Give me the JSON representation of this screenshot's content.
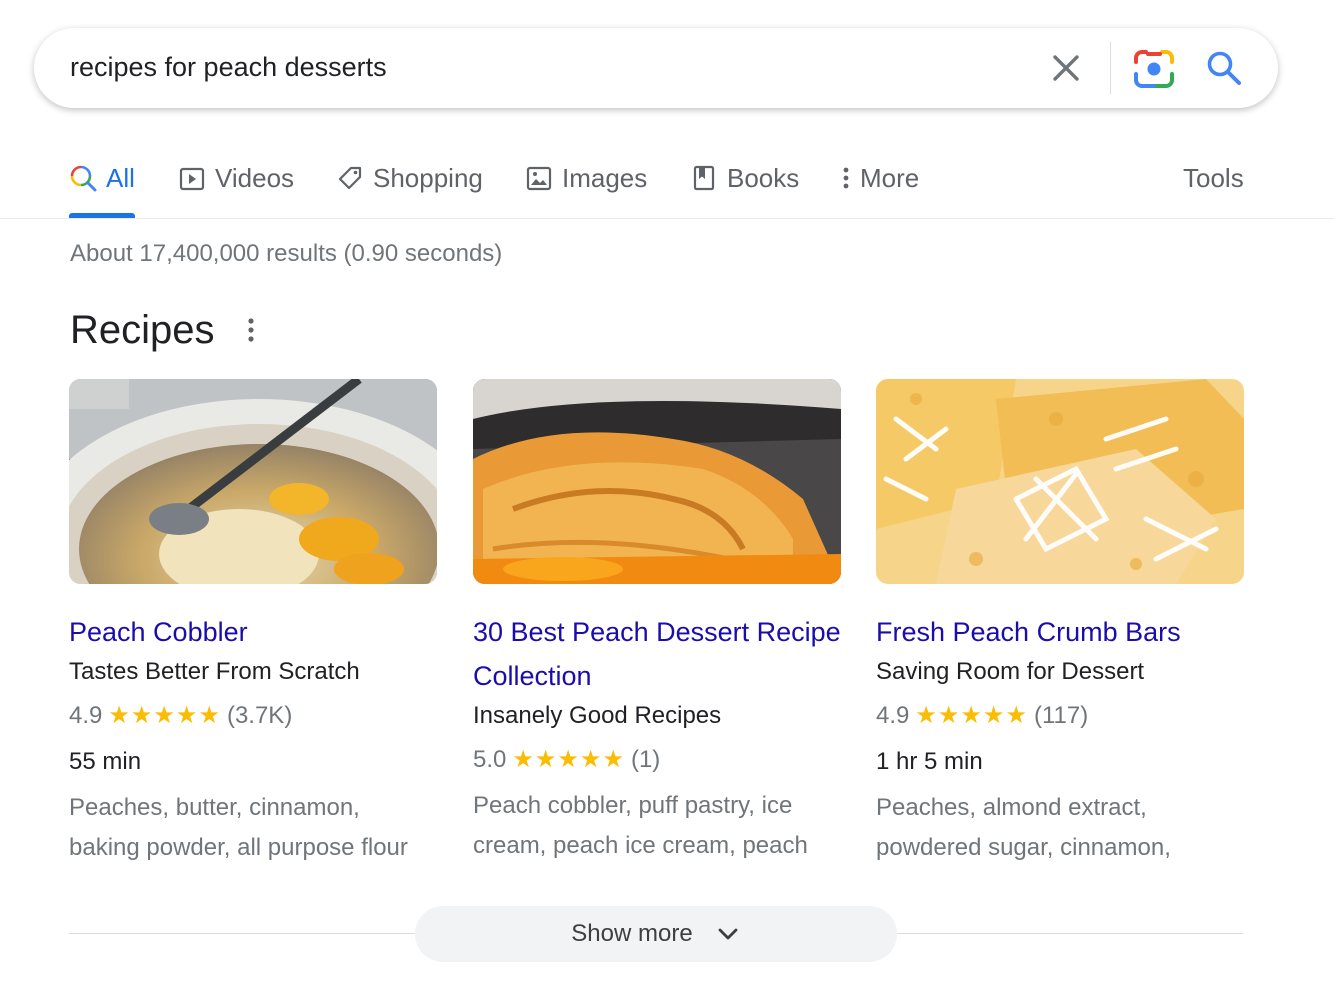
{
  "search": {
    "query": "recipes for peach desserts"
  },
  "tabs": [
    {
      "label": "All",
      "icon": "search-multicolor-icon",
      "active": true
    },
    {
      "label": "Videos",
      "icon": "play-icon"
    },
    {
      "label": "Shopping",
      "icon": "tag-icon"
    },
    {
      "label": "Images",
      "icon": "image-icon"
    },
    {
      "label": "Books",
      "icon": "book-icon"
    },
    {
      "label": "More",
      "icon": "vertical-dots-icon"
    }
  ],
  "tools_label": "Tools",
  "result_stats": "About 17,400,000 results (0.90 seconds)",
  "section": {
    "title": "Recipes"
  },
  "recipes": [
    {
      "title": "Peach Cobbler",
      "source": "Tastes Better From Scratch",
      "rating": "4.9",
      "stars": "★★★★★",
      "reviews": "(3.7K)",
      "time": "55 min",
      "ingredients": "Peaches, butter, cinnamon, baking powder, all purpose flour"
    },
    {
      "title": "30 Best Peach Dessert Recipe Collection",
      "source": "Insanely Good Recipes",
      "rating": "5.0",
      "stars": "★★★★★",
      "reviews": "(1)",
      "ingredients": "Peach cobbler, puff pastry, ice cream, peach ice cream, peach"
    },
    {
      "title": "Fresh Peach Crumb Bars",
      "source": "Saving Room for Dessert",
      "rating": "4.9",
      "stars": "★★★★★",
      "reviews": "(117)",
      "time": "1 hr 5 min",
      "ingredients": "Peaches, almond extract, powdered sugar, cinnamon,"
    }
  ],
  "show_more_label": "Show more",
  "colors": {
    "link": "#1a0dab",
    "accent": "#1a73e8",
    "star": "#fbbc04",
    "muted": "#70757a"
  }
}
